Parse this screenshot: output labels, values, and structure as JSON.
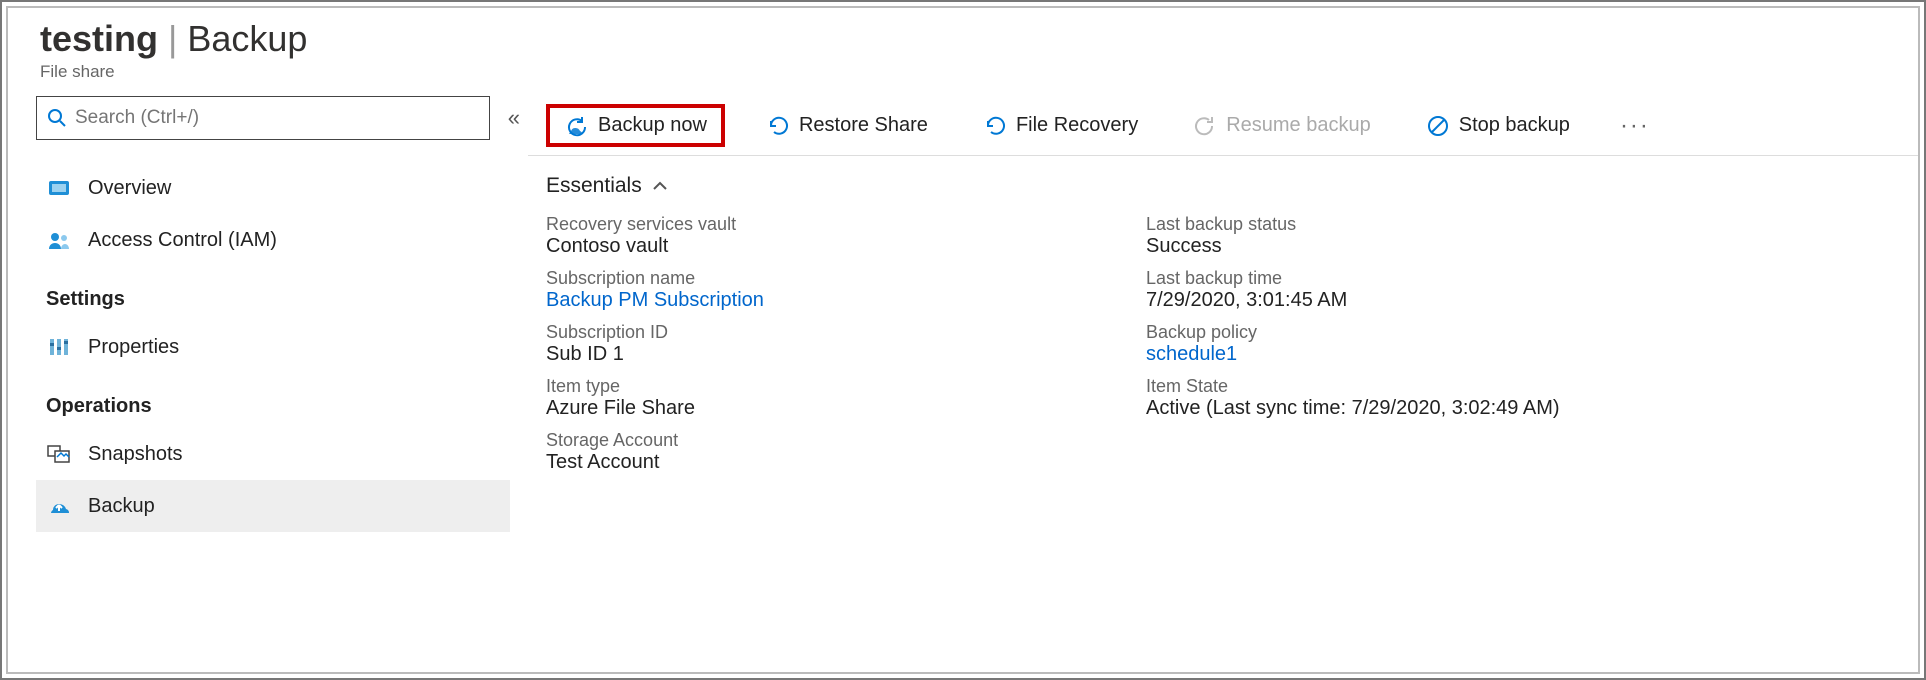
{
  "header": {
    "resource_name": "testing",
    "separator": "|",
    "page_name": "Backup",
    "subtitle": "File share"
  },
  "search": {
    "placeholder": "Search (Ctrl+/)"
  },
  "sidebar": {
    "items_top": [
      {
        "label": "Overview"
      },
      {
        "label": "Access Control (IAM)"
      }
    ],
    "section_settings": "Settings",
    "items_settings": [
      {
        "label": "Properties"
      }
    ],
    "section_operations": "Operations",
    "items_operations": [
      {
        "label": "Snapshots"
      },
      {
        "label": "Backup"
      }
    ]
  },
  "toolbar": {
    "backup_now": "Backup now",
    "restore_share": "Restore Share",
    "file_recovery": "File Recovery",
    "resume_backup": "Resume backup",
    "stop_backup": "Stop backup"
  },
  "essentials": {
    "heading": "Essentials",
    "left": {
      "recovery_vault_lbl": "Recovery services vault",
      "recovery_vault_val": "Contoso vault",
      "subscription_name_lbl": "Subscription name",
      "subscription_name_val": "Backup PM Subscription",
      "subscription_id_lbl": "Subscription ID",
      "subscription_id_val": "Sub ID 1",
      "item_type_lbl": "Item type",
      "item_type_val": "Azure File Share",
      "storage_account_lbl": "Storage Account",
      "storage_account_val": "Test Account"
    },
    "right": {
      "last_backup_status_lbl": "Last backup status",
      "last_backup_status_val": "Success",
      "last_backup_time_lbl": "Last backup time",
      "last_backup_time_val": "7/29/2020, 3:01:45 AM",
      "backup_policy_lbl": "Backup policy",
      "backup_policy_val": "schedule1",
      "item_state_lbl": "Item State",
      "item_state_val": "Active (Last sync time: 7/29/2020, 3:02:49 AM)"
    }
  }
}
